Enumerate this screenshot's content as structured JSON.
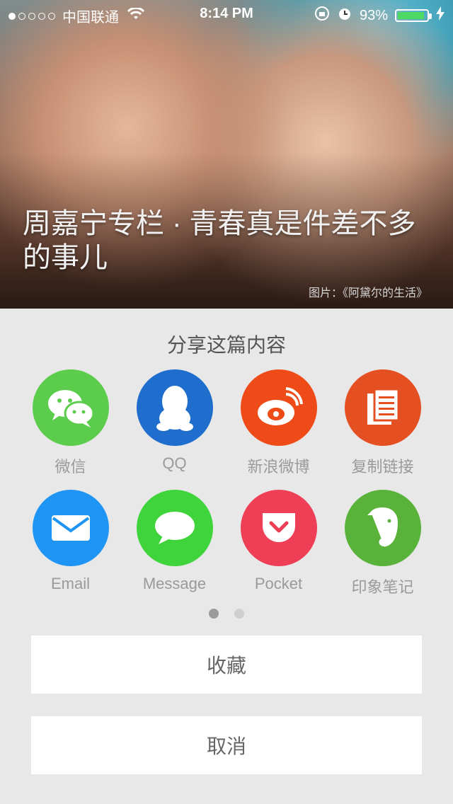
{
  "status_bar": {
    "carrier": "中国联通",
    "time": "8:14 PM",
    "battery_percent": "93%",
    "battery_level": 0.93,
    "signal_dots_filled": 1,
    "signal_dots_total": 5
  },
  "hero": {
    "title": "周嘉宁专栏 · 青春真是件差不多的事儿",
    "caption": "图片：《阿黛尔的生活》"
  },
  "share_sheet": {
    "title": "分享这篇内容",
    "items": [
      {
        "label": "微信",
        "icon": "wechat-icon",
        "color": "#5ccc4d"
      },
      {
        "label": "QQ",
        "icon": "qq-penguin-icon",
        "color": "#1f6dcc"
      },
      {
        "label": "新浪微博",
        "icon": "weibo-icon",
        "color": "#ee4b18"
      },
      {
        "label": "复制链接",
        "icon": "copy-link-icon",
        "color": "#e55022"
      },
      {
        "label": "Email",
        "icon": "mail-icon",
        "color": "#1e95f5"
      },
      {
        "label": "Message",
        "icon": "message-bubble-icon",
        "color": "#3fd43b"
      },
      {
        "label": "Pocket",
        "icon": "pocket-icon",
        "color": "#ef3f56"
      },
      {
        "label": "印象笔记",
        "icon": "evernote-icon",
        "color": "#59b23a"
      }
    ],
    "pager": {
      "current": 1,
      "total": 2
    },
    "favorite_label": "收藏",
    "cancel_label": "取消"
  }
}
